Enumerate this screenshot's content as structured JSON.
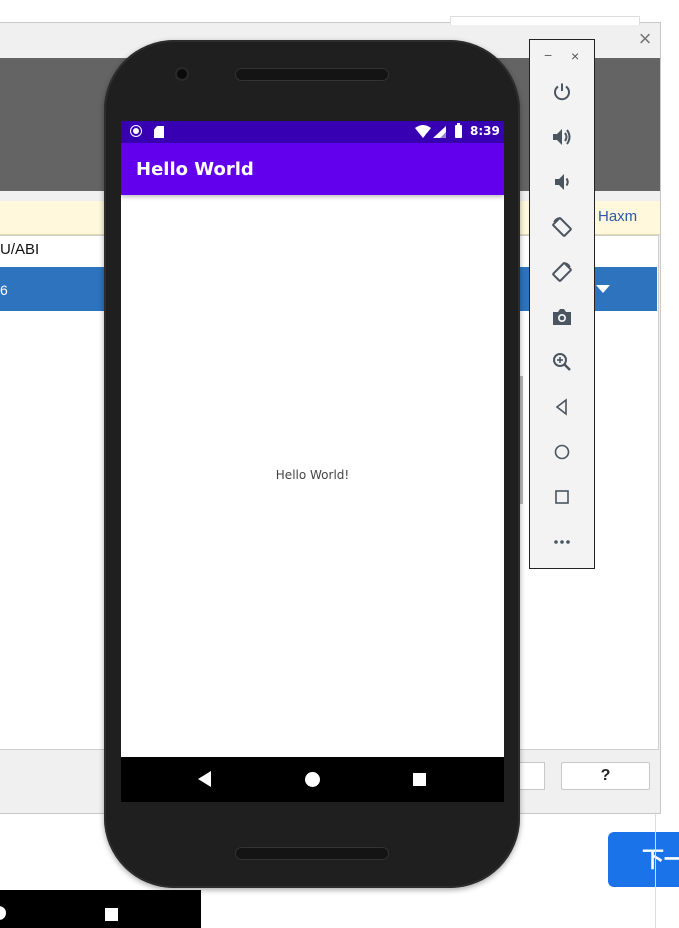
{
  "background_dialog": {
    "warning_link": "Haxm",
    "column_header": "U/ABI",
    "selected_row_text": "6",
    "help_button": "?",
    "next_button": "下一"
  },
  "emulator": {
    "status_bar": {
      "time": "8:39"
    },
    "app_bar": {
      "title": "Hello World"
    },
    "content": {
      "text": "Hello World!"
    },
    "nav_bar": {
      "items": [
        "back",
        "home",
        "recents"
      ]
    }
  },
  "toolbar": {
    "minimize_label": "−",
    "close_label": "×",
    "icons": [
      "power-icon",
      "volume-up-icon",
      "volume-down-icon",
      "rotate-left-icon",
      "rotate-right-icon",
      "camera-icon",
      "zoom-icon",
      "back-icon",
      "home-icon",
      "overview-icon",
      "more-icon"
    ]
  }
}
